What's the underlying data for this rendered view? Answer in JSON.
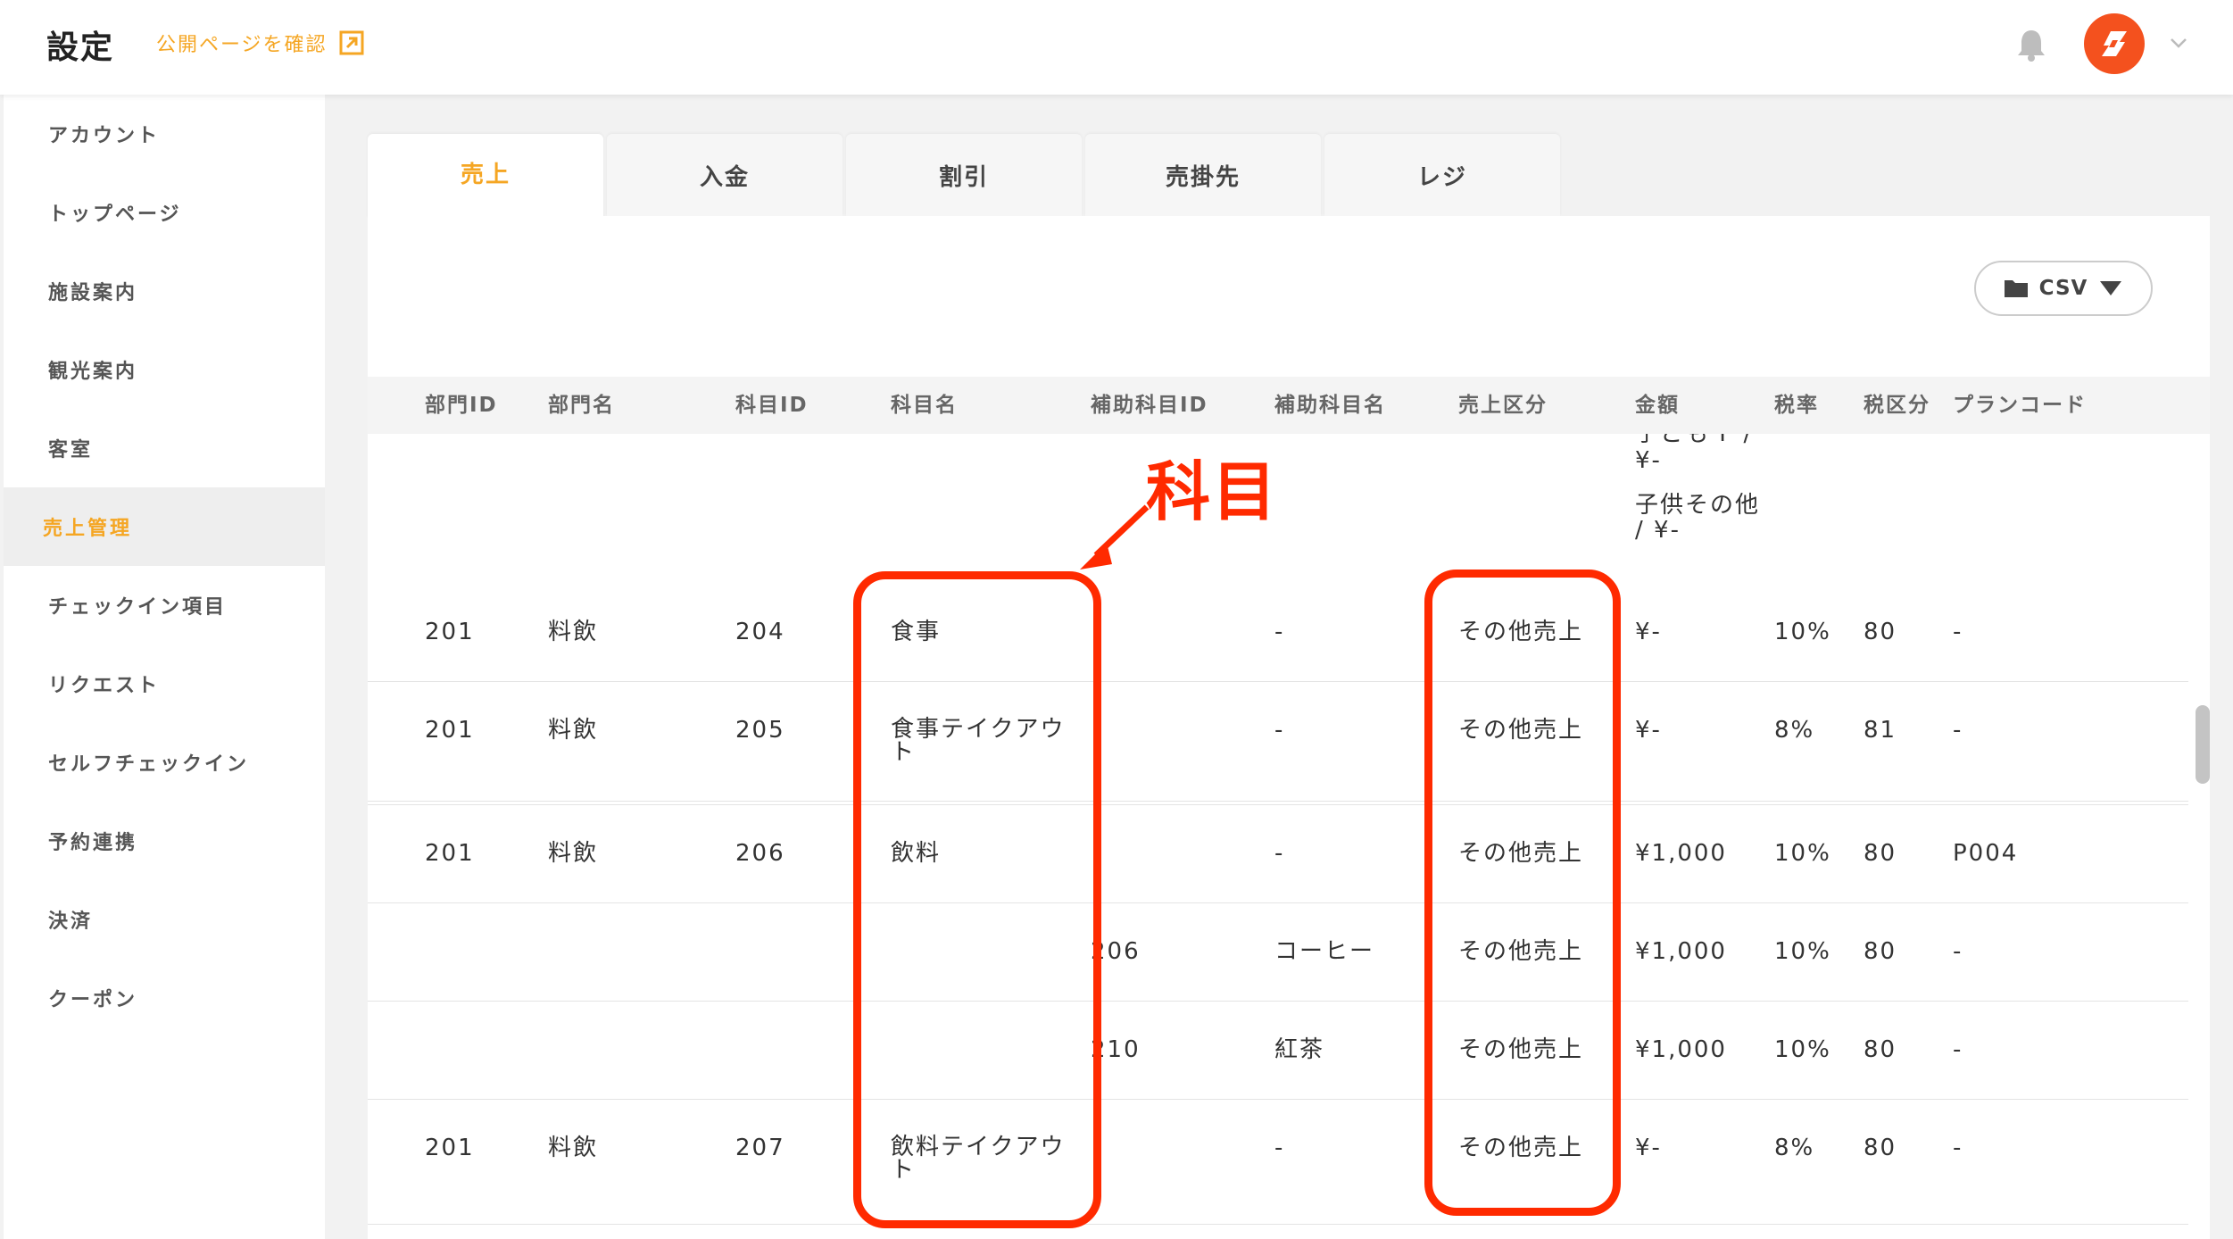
{
  "header": {
    "title": "設定",
    "public_link": "公開ページを確認"
  },
  "sidebar": {
    "items": [
      {
        "label": "アカウント"
      },
      {
        "label": "トップページ"
      },
      {
        "label": "施設案内"
      },
      {
        "label": "観光案内"
      },
      {
        "label": "客室"
      },
      {
        "label": "売上管理",
        "active": true
      },
      {
        "label": "チェックイン項目"
      },
      {
        "label": "リクエスト"
      },
      {
        "label": "セルフチェックイン"
      },
      {
        "label": "予約連携"
      },
      {
        "label": "決済"
      },
      {
        "label": "クーポン"
      }
    ]
  },
  "tabs": [
    {
      "label": "売上",
      "active": true
    },
    {
      "label": "入金"
    },
    {
      "label": "割引"
    },
    {
      "label": "売掛先"
    },
    {
      "label": "レジ"
    }
  ],
  "csv_button": "CSV",
  "table": {
    "headers": [
      "部門ID",
      "部門名",
      "科目ID",
      "科目名",
      "補助科目ID",
      "補助科目名",
      "売上区分",
      "金額",
      "税率",
      "税区分",
      "プランコード"
    ],
    "partial_row": {
      "amount_line1": "子ども F /",
      "amount_line2": "¥-",
      "amount_line3": "子供その他",
      "amount_line4": "/ ¥-"
    },
    "rows": [
      {
        "dept_id": "201",
        "dept_name": "料飲",
        "item_id": "204",
        "item_name": "食事",
        "sub_id": "",
        "sub_name": "-",
        "category": "その他売上",
        "amount": "¥-",
        "tax_rate": "10%",
        "tax_class": "80",
        "plan_code": "-"
      },
      {
        "dept_id": "201",
        "dept_name": "料飲",
        "item_id": "205",
        "item_name": "食事テイクアウト",
        "sub_id": "",
        "sub_name": "-",
        "category": "その他売上",
        "amount": "¥-",
        "tax_rate": "8%",
        "tax_class": "81",
        "plan_code": "-"
      },
      {
        "dept_id": "201",
        "dept_name": "料飲",
        "item_id": "206",
        "item_name": "飲料",
        "sub_id": "",
        "sub_name": "-",
        "category": "その他売上",
        "amount": "¥1,000",
        "tax_rate": "10%",
        "tax_class": "80",
        "plan_code": "P004"
      },
      {
        "dept_id": "",
        "dept_name": "",
        "item_id": "",
        "item_name": "",
        "sub_id": "206",
        "sub_name": "コーヒー",
        "category": "その他売上",
        "amount": "¥1,000",
        "tax_rate": "10%",
        "tax_class": "80",
        "plan_code": "-"
      },
      {
        "dept_id": "",
        "dept_name": "",
        "item_id": "",
        "item_name": "",
        "sub_id": "210",
        "sub_name": "紅茶",
        "category": "その他売上",
        "amount": "¥1,000",
        "tax_rate": "10%",
        "tax_class": "80",
        "plan_code": "-"
      },
      {
        "dept_id": "201",
        "dept_name": "料飲",
        "item_id": "207",
        "item_name": "飲料テイクアウト",
        "sub_id": "",
        "sub_name": "-",
        "category": "その他売上",
        "amount": "¥-",
        "tax_rate": "8%",
        "tax_class": "80",
        "plan_code": "-"
      }
    ]
  },
  "annotation": {
    "label": "科目",
    "color": "#ff2a00"
  },
  "colors": {
    "accent": "#f5a623",
    "avatar": "#f4511e"
  }
}
